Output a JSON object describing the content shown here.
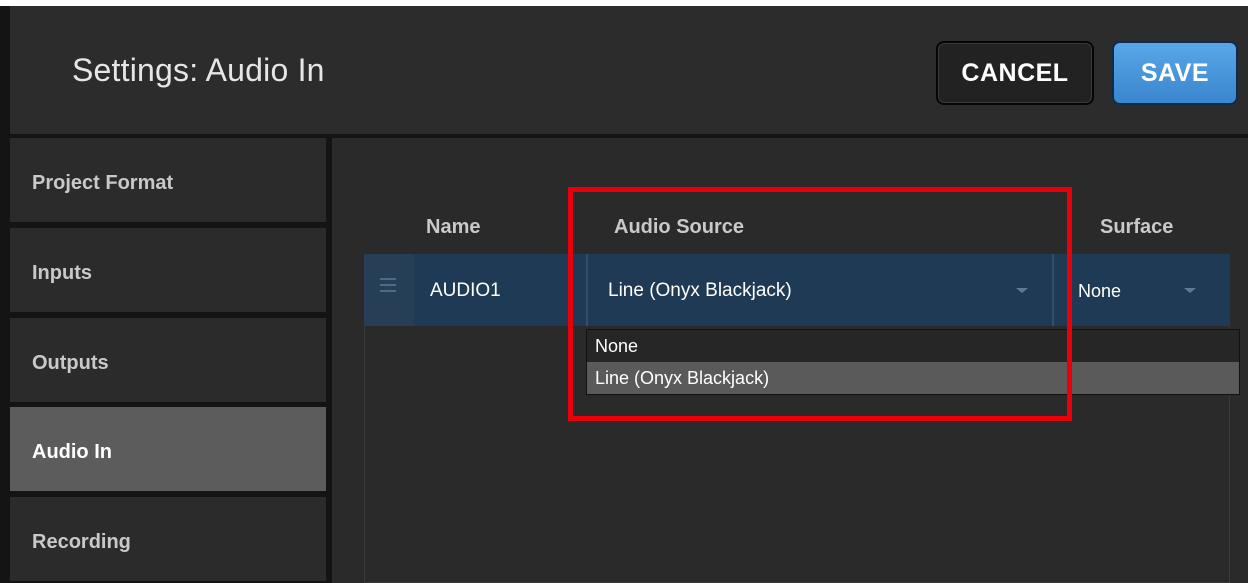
{
  "header": {
    "title": "Settings: Audio In",
    "cancel_label": "CANCEL",
    "save_label": "SAVE"
  },
  "sidebar": {
    "items": [
      {
        "label": "Project Format",
        "active": false
      },
      {
        "label": "Inputs",
        "active": false
      },
      {
        "label": "Outputs",
        "active": false
      },
      {
        "label": "Audio In",
        "active": true
      },
      {
        "label": "Recording",
        "active": false
      }
    ]
  },
  "table": {
    "columns": {
      "name": "Name",
      "source": "Audio Source",
      "surface": "Surface"
    },
    "row": {
      "name": "AUDIO1",
      "source": "Line (Onyx Blackjack)",
      "surface": "None"
    }
  },
  "dropdown": {
    "options": [
      "None",
      "Line (Onyx Blackjack)"
    ],
    "highlighted": "Line (Onyx Blackjack)"
  },
  "colors": {
    "accent": "#3a86cf",
    "highlight_box": "#e8000b",
    "row_selected": "#1f3a55"
  }
}
